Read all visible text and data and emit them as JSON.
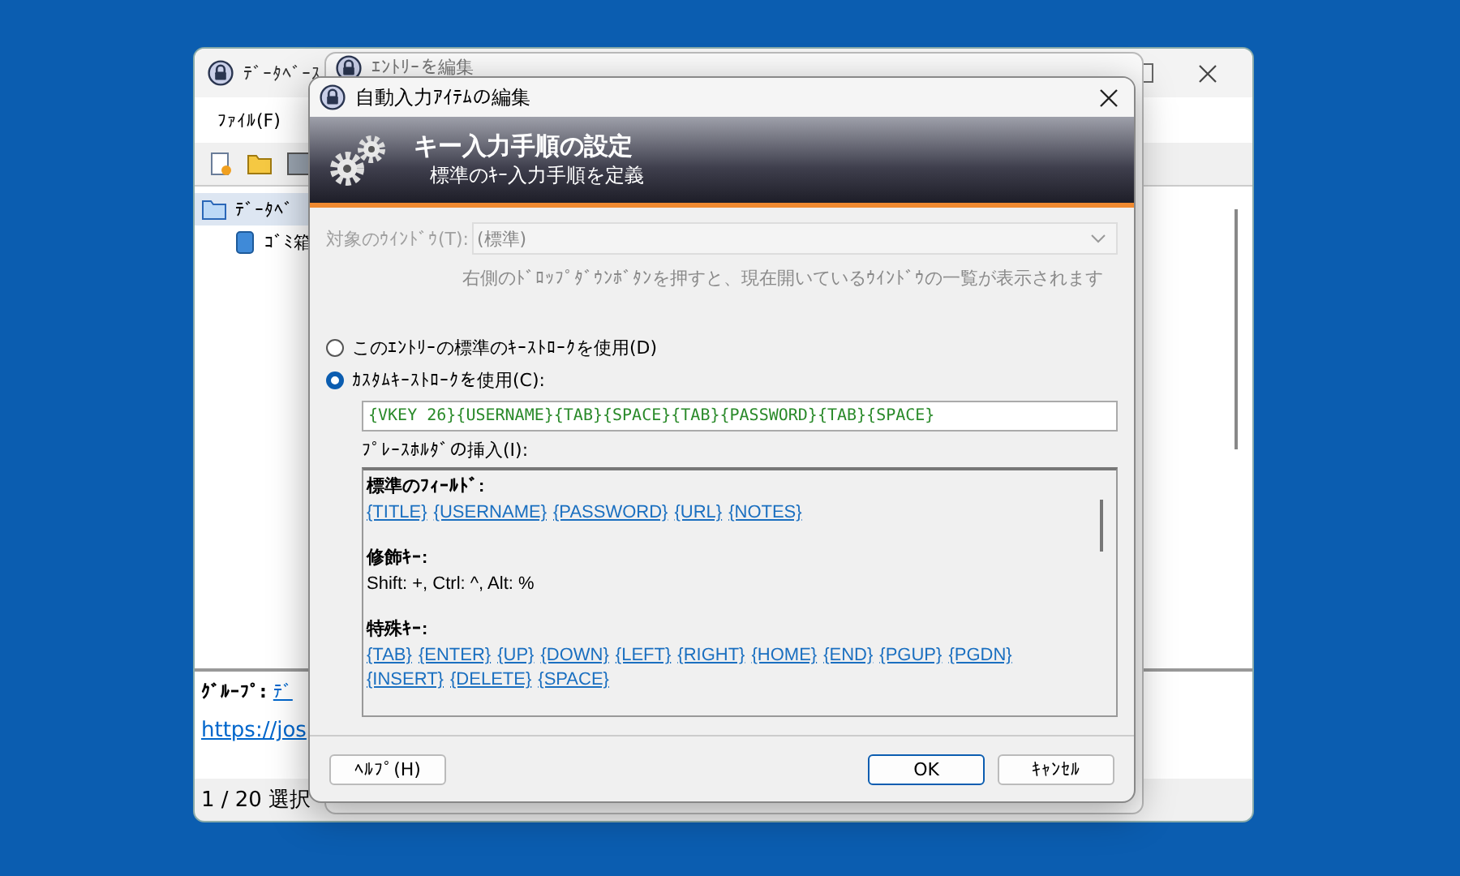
{
  "main_window": {
    "title": "ﾃﾞｰﾀﾍﾞｰｽ",
    "menu": [
      "ﾌｧｲﾙ(F)"
    ],
    "toolbar": [
      {
        "kind": "new"
      },
      {
        "kind": "open"
      },
      {
        "kind": "save"
      }
    ],
    "tree": [
      {
        "label": "ﾃﾞｰﾀﾍﾞ",
        "kind": "folder",
        "selected": true
      },
      {
        "label": "ｺﾞﾐ箱",
        "kind": "bin",
        "selected": false
      }
    ],
    "group_label": "ｸﾞﾙｰﾌﾟ:",
    "group_link": "ﾃﾞ",
    "url": "https://jos",
    "status": "1 / 20 選択"
  },
  "middle_window": {
    "title": "ｴﾝﾄﾘｰを編集"
  },
  "dialog": {
    "title": "自動入力ｱｲﾃﾑの編集",
    "banner_title": "キー入力手順の設定",
    "banner_subtitle": "標準のｷｰ入力手順を定義",
    "target_label": "対象のｳｲﾝﾄﾞｳ(T):",
    "target_value": "(標準)",
    "target_disabled": true,
    "hint": "右側のﾄﾞﾛｯﾌﾟﾀﾞｳﾝﾎﾞﾀﾝを押すと、現在開いているｳｲﾝﾄﾞｳの一覧が表示されます",
    "options": [
      {
        "label": "このｴﾝﾄﾘｰの標準のｷｰｽﾄﾛｰｸを使用(D)",
        "selected": false
      },
      {
        "label": "ｶｽﾀﾑｷｰｽﾄﾛｰｸを使用(C):",
        "selected": true
      }
    ],
    "sequence": "{VKEY 26}{USERNAME}{TAB}{SPACE}{TAB}{PASSWORD}{TAB}{SPACE}",
    "placeholders_label": "ﾌﾟﾚｰｽﾎﾙﾀﾞの挿入(I):",
    "sections": [
      {
        "heading": "標準のﾌｨｰﾙﾄﾞ:",
        "kind": "links",
        "items": [
          "{TITLE}",
          "{USERNAME}",
          "{PASSWORD}",
          "{URL}",
          "{NOTES}"
        ]
      },
      {
        "heading": "修飾ｷｰ:",
        "kind": "text",
        "text": "Shift: +, Ctrl: ^, Alt: %"
      },
      {
        "heading": "特殊ｷｰ:",
        "kind": "links",
        "items": [
          "{TAB}",
          "{ENTER}",
          "{UP}",
          "{DOWN}",
          "{LEFT}",
          "{RIGHT}",
          "{HOME}",
          "{END}",
          "{PGUP}",
          "{PGDN}",
          "{INSERT}",
          "{DELETE}",
          "{SPACE}"
        ]
      }
    ],
    "buttons": [
      {
        "label": "ﾍﾙﾌﾟ(H)",
        "kind": "help"
      },
      {
        "label": "OK",
        "kind": "default"
      },
      {
        "label": "ｷｬﾝｾﾙ",
        "kind": "normal"
      }
    ]
  }
}
